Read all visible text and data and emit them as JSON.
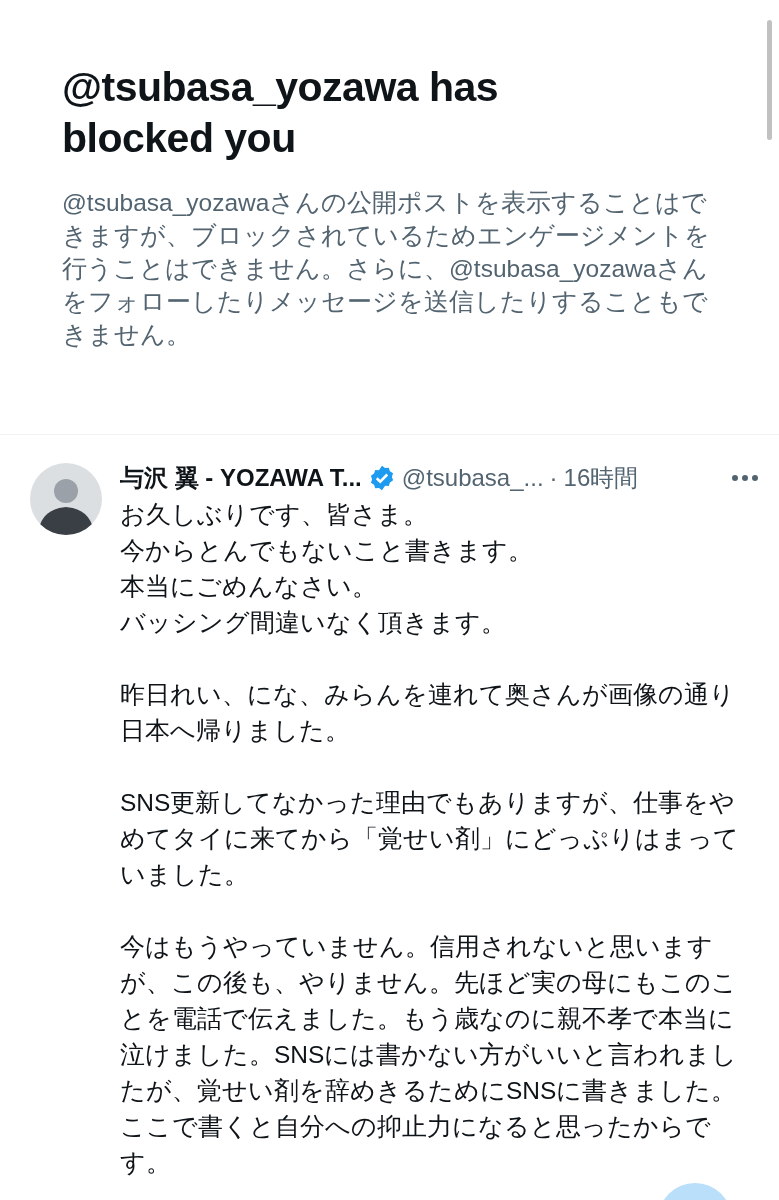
{
  "blocked_notice": {
    "title": "@tsubasa_yozawa has blocked you",
    "description": "@tsubasa_yozawaさんの公開ポストを表示することはできますが、ブロックされているためエンゲージメントを行うことはできません。さらに、@tsubasa_yozawaさんをフォローしたりメッセージを送信したりすることもできません。"
  },
  "post": {
    "display_name": "与沢 翼 - YOZAWA T...",
    "verified": true,
    "handle": "@tsubasa_...",
    "separator": "·",
    "time": "16時間",
    "paragraphs": [
      [
        "お久しぶりです、皆さま。",
        "今からとんでもないこと書きます。",
        "本当にごめんなさい。",
        "バッシング間違いなく頂きます。"
      ],
      [
        "昨日れい、にな、みらんを連れて奥さんが画像の通り日本へ帰りました。"
      ],
      [
        "SNS更新してなかった理由でもありますが、仕事をやめてタイに来てから「覚せい剤」にどっぷりはまっていました。"
      ],
      [
        "今はもうやっていません。信用されないと思いますが、この後も、やりません。先ほど実の母にもこのことを電話で伝えました。もう歳なのに親不孝で本当に泣けました。SNSには書かない方がいいと言われましたが、覚せい剤を辞めきるためにSNSに書きました。ここで書くと自分への抑止力になると思ったからです。"
      ]
    ]
  }
}
